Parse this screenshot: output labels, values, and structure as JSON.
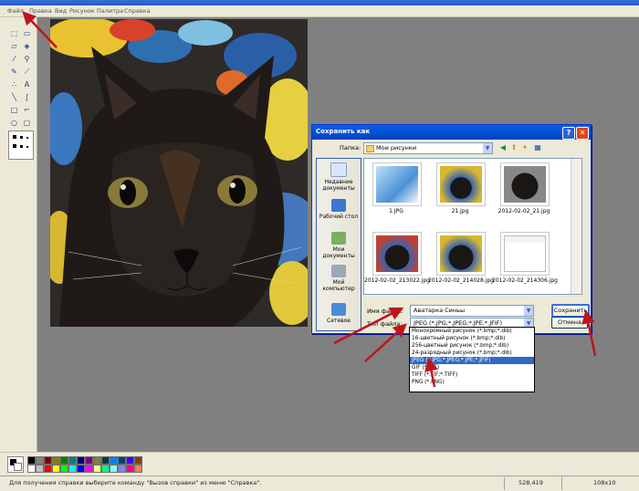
{
  "menubar": {
    "items": [
      "Файл",
      "Правка",
      "Вид",
      "Рисунок",
      "Палитра",
      "Справка"
    ]
  },
  "save_dialog": {
    "title": "Сохранить как",
    "folder_label": "Папка:",
    "folder_value": "Мои рисунки",
    "places": [
      "Недавние документы",
      "Рабочий стол",
      "Мои документы",
      "Мой компьютер",
      "Сетевое"
    ],
    "files": [
      "1.JPG",
      "21.jpg",
      "2012-02-02_21.jpg",
      "2012-02-02_213022.jpg",
      "2012-02-02_214028.jpg",
      "2012-02-02_214306.jpg"
    ],
    "filename_label": "Имя файла:",
    "filename_value": "Аватарка Синьы",
    "filetype_label": "Тип файла:",
    "filetype_value": "JPEG (*.JPG;*.JPEG;*.JPE;*.JFIF)",
    "save_button": "Сохранить",
    "cancel_button": "Отмена",
    "help_button": "?",
    "close_button": "✕",
    "filetype_options": [
      "Монохромный рисунок (*.bmp;*.dib)",
      "16-цветный рисунок (*.bmp;*.dib)",
      "256-цветный рисунок (*.bmp;*.dib)",
      "24-разрядный рисунок (*.bmp;*.dib)",
      "JPEG (*.JPG;*.JPEG;*.JPE;*.JFIF)",
      "GIF (*.GIF)",
      "TIFF (*.TIF;*.TIFF)",
      "PNG (*.PNG)"
    ],
    "selected_option_index": 4
  },
  "statusbar": {
    "help_text": "Для получения справки выберите команду \"Вызов справки\" из меню \"Справка\".",
    "coords": "528,419",
    "size": "108x10"
  },
  "palette_colors": [
    "#000000",
    "#808080",
    "#800000",
    "#808000",
    "#008000",
    "#008080",
    "#000080",
    "#800080",
    "#808040",
    "#004040",
    "#0080ff",
    "#004080",
    "#4000ff",
    "#804000",
    "#ffffff",
    "#c0c0c0",
    "#ff0000",
    "#ffff00",
    "#00ff00",
    "#00ffff",
    "#0000ff",
    "#ff00ff",
    "#ffff80",
    "#00ff80",
    "#80ffff",
    "#8080ff",
    "#ff0080",
    "#ff8040"
  ],
  "colors": {
    "accent": "#0550d1",
    "annotation_arrows": "#c0141c",
    "selection": "#316ac5"
  }
}
